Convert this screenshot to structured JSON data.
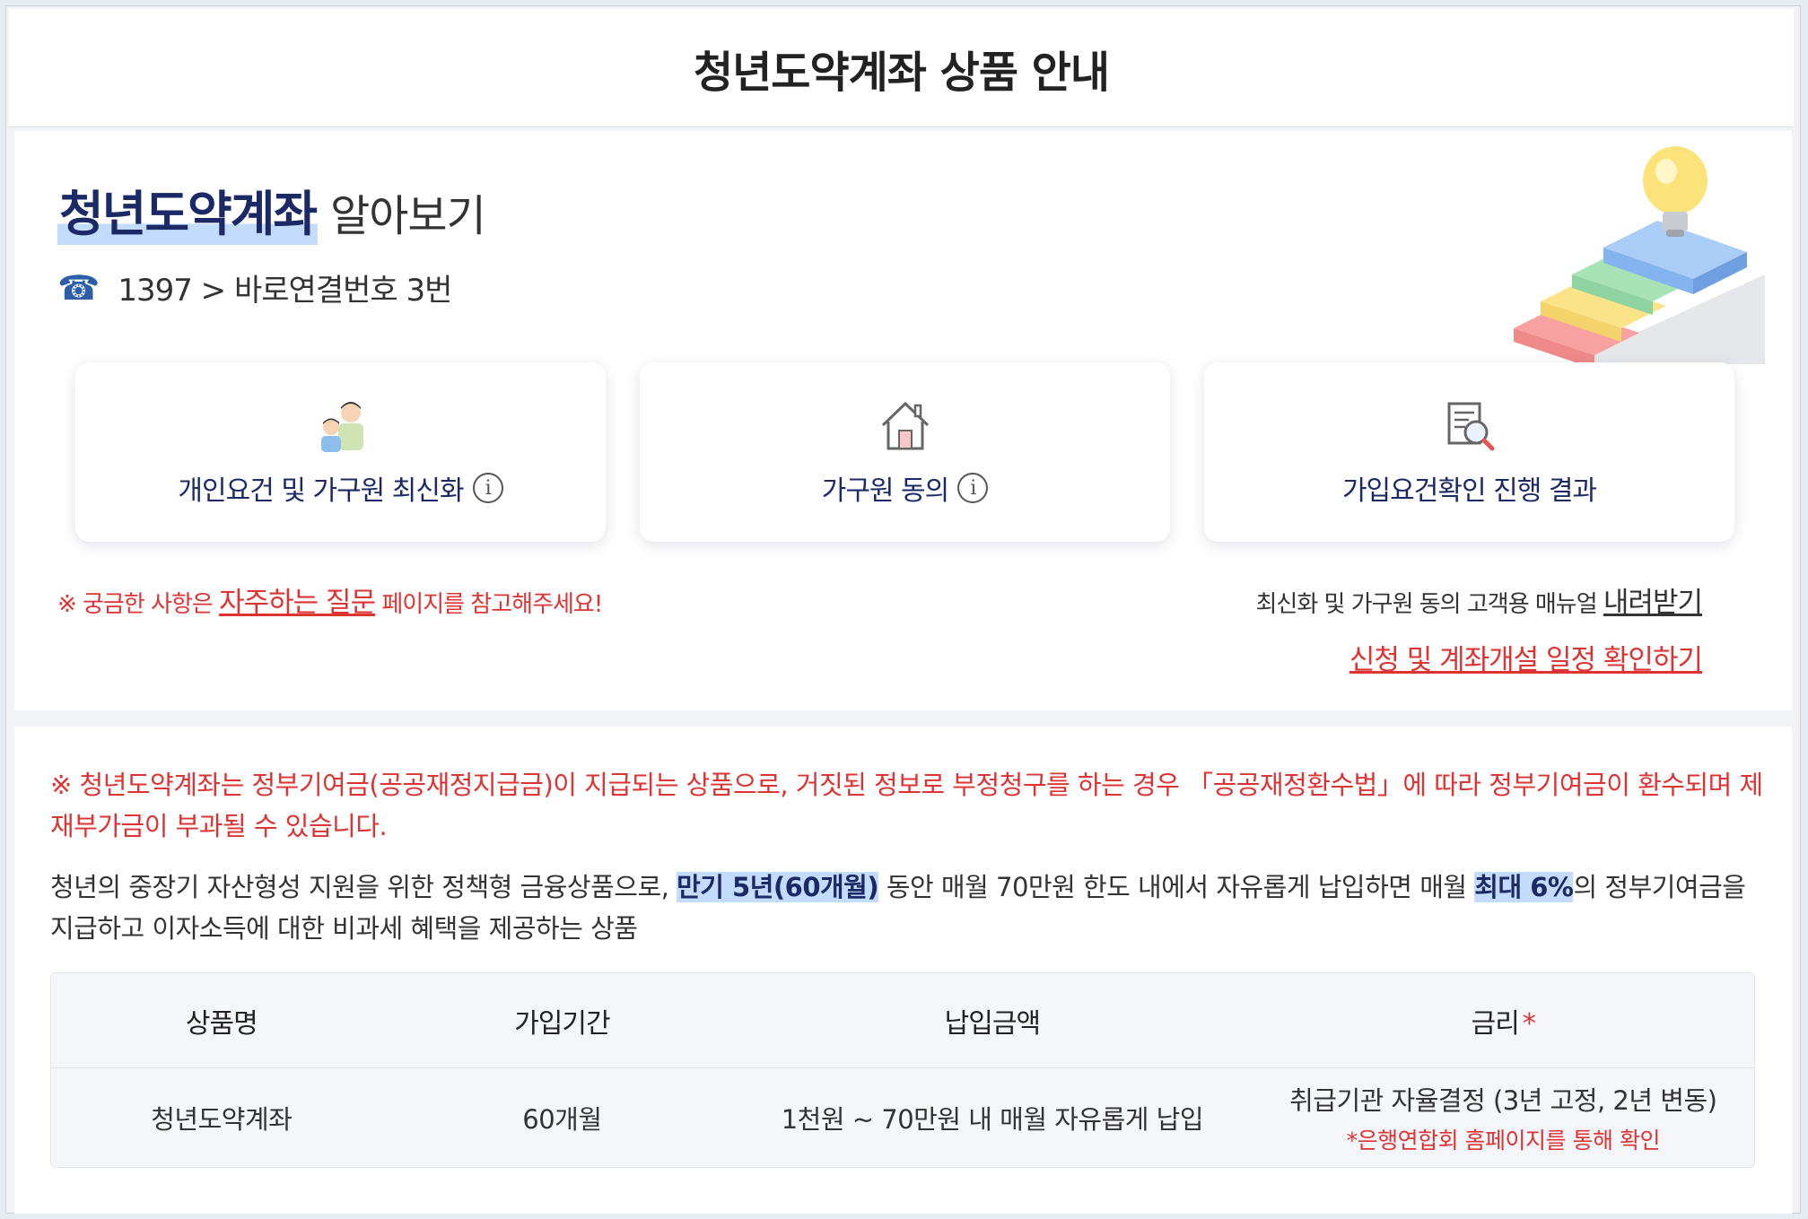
{
  "page": {
    "title": "청년도약계좌 상품 안내"
  },
  "intro": {
    "heading_highlight": "청년도약계좌",
    "heading_rest": "알아보기",
    "phone_icon": "phone-icon",
    "phone_text": "1397 > 바로연결번호 3번"
  },
  "services": [
    {
      "label": "개인요건 및 가구원 최신화",
      "icon": "family-icon",
      "has_info": true
    },
    {
      "label": "가구원 동의",
      "icon": "house-icon",
      "has_info": true
    },
    {
      "label": "가입요건확인 진행 결과",
      "icon": "document-search-icon",
      "has_info": false
    }
  ],
  "notices": {
    "faq_prefix": "※ 궁금한 사항은 ",
    "faq_link": "자주하는 질문",
    "faq_suffix": " 페이지를 참고해주세요!",
    "manual_text": "최신화 및 가구원 동의 고객용 매뉴얼 ",
    "manual_link": "내려받기",
    "schedule_link": "신청 및 계좌개설 일정 확인하기"
  },
  "product": {
    "warning": "※ 청년도약계좌는 정부기여금(공공재정지급금)이 지급되는 상품으로, 거짓된 정보로 부정청구를 하는 경우 「공공재정환수법」에 따라 정부기여금이 환수되며 제재부가금이 부과될 수 있습니다.",
    "desc_1": "청년의 중장기 자산형성 지원을 위한 정책형 금융상품으로, ",
    "desc_mark_1": "만기 5년(60개월)",
    "desc_2": " 동안 매월 70만원 한도 내에서 자유롭게 납입하면 매월 ",
    "desc_mark_2": "최대 6%",
    "desc_3": "의 정부기여금을 지급하고 이자소득에 대한 비과세 혜택을 제공하는 상품"
  },
  "table": {
    "headers": [
      "상품명",
      "가입기간",
      "납입금액",
      "금리"
    ],
    "required_mark": "*",
    "row": {
      "name": "청년도약계좌",
      "period": "60개월",
      "amount": "1천원 ~ 70만원 내 매월 자유롭게 납입",
      "rate": "취급기관 자율결정 (3년 고정, 2년 변동)",
      "rate_note": "*은행연합회 홈페이지를 통해 확인"
    }
  },
  "colors": {
    "brand_navy": "#1b2a66",
    "alert_red": "#dd3333",
    "highlight_blue": "#c3dcfb"
  }
}
